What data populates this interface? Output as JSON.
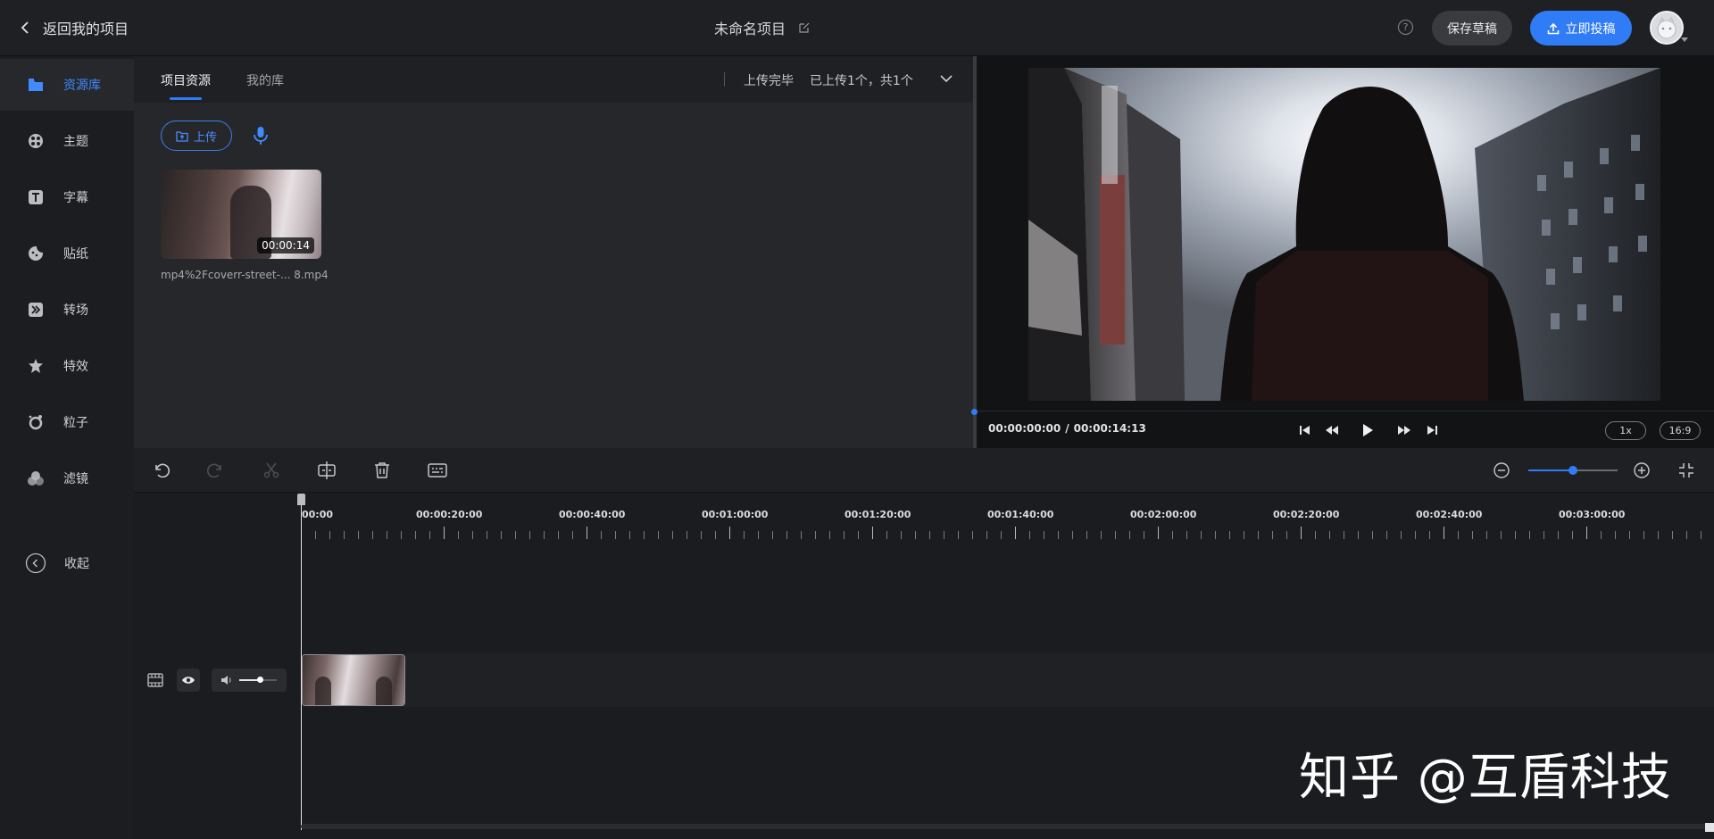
{
  "header": {
    "back_label": "返回我的项目",
    "project_title": "未命名项目",
    "help_glyph": "?",
    "save_label": "保存草稿",
    "publish_label": "立即投稿"
  },
  "sidebar": {
    "items": [
      {
        "label": "资源库",
        "icon": "library-icon",
        "active": true
      },
      {
        "label": "主题",
        "icon": "theme-icon"
      },
      {
        "label": "字幕",
        "icon": "subtitle-icon"
      },
      {
        "label": "贴纸",
        "icon": "sticker-icon"
      },
      {
        "label": "转场",
        "icon": "transition-icon"
      },
      {
        "label": "特效",
        "icon": "effects-icon"
      },
      {
        "label": "粒子",
        "icon": "particle-icon"
      },
      {
        "label": "滤镜",
        "icon": "filter-icon"
      }
    ],
    "collapse_label": "收起"
  },
  "assets": {
    "tabs": [
      {
        "label": "项目资源",
        "active": true
      },
      {
        "label": "我的库",
        "active": false
      }
    ],
    "upload_status": "上传完毕",
    "upload_count": "已上传1个，共1个",
    "upload_button": "上传",
    "items": [
      {
        "name": "mp4%2Fcoverr-street-... 8.mp4",
        "duration": "00:00:14"
      }
    ]
  },
  "preview": {
    "current_time": "00:00:00:00",
    "separator": "/",
    "total_time": "00:00:14:13",
    "speed": "1x",
    "aspect": "16:9"
  },
  "timeline": {
    "ruler_labels": [
      "00:00",
      "00:00:20:00",
      "00:00:40:00",
      "00:01:00:00",
      "00:01:20:00",
      "00:01:40:00",
      "00:02:00:00",
      "00:02:20:00",
      "00:02:40:00",
      "00:03:00:00"
    ],
    "zoom_level": 0.5
  },
  "watermark": "知乎 @互盾科技",
  "colors": {
    "accent": "#2f7cf6",
    "background": "#1b1c1f",
    "panel": "#26272a"
  }
}
